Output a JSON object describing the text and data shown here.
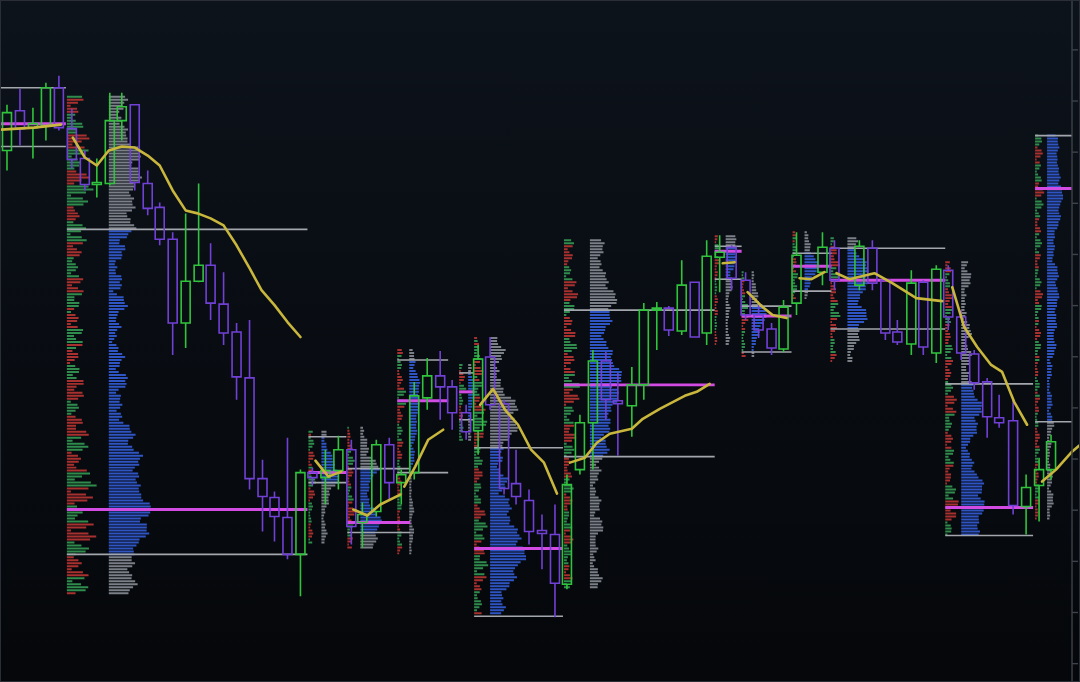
{
  "chart": {
    "kind": "candlestick"
  }
}
